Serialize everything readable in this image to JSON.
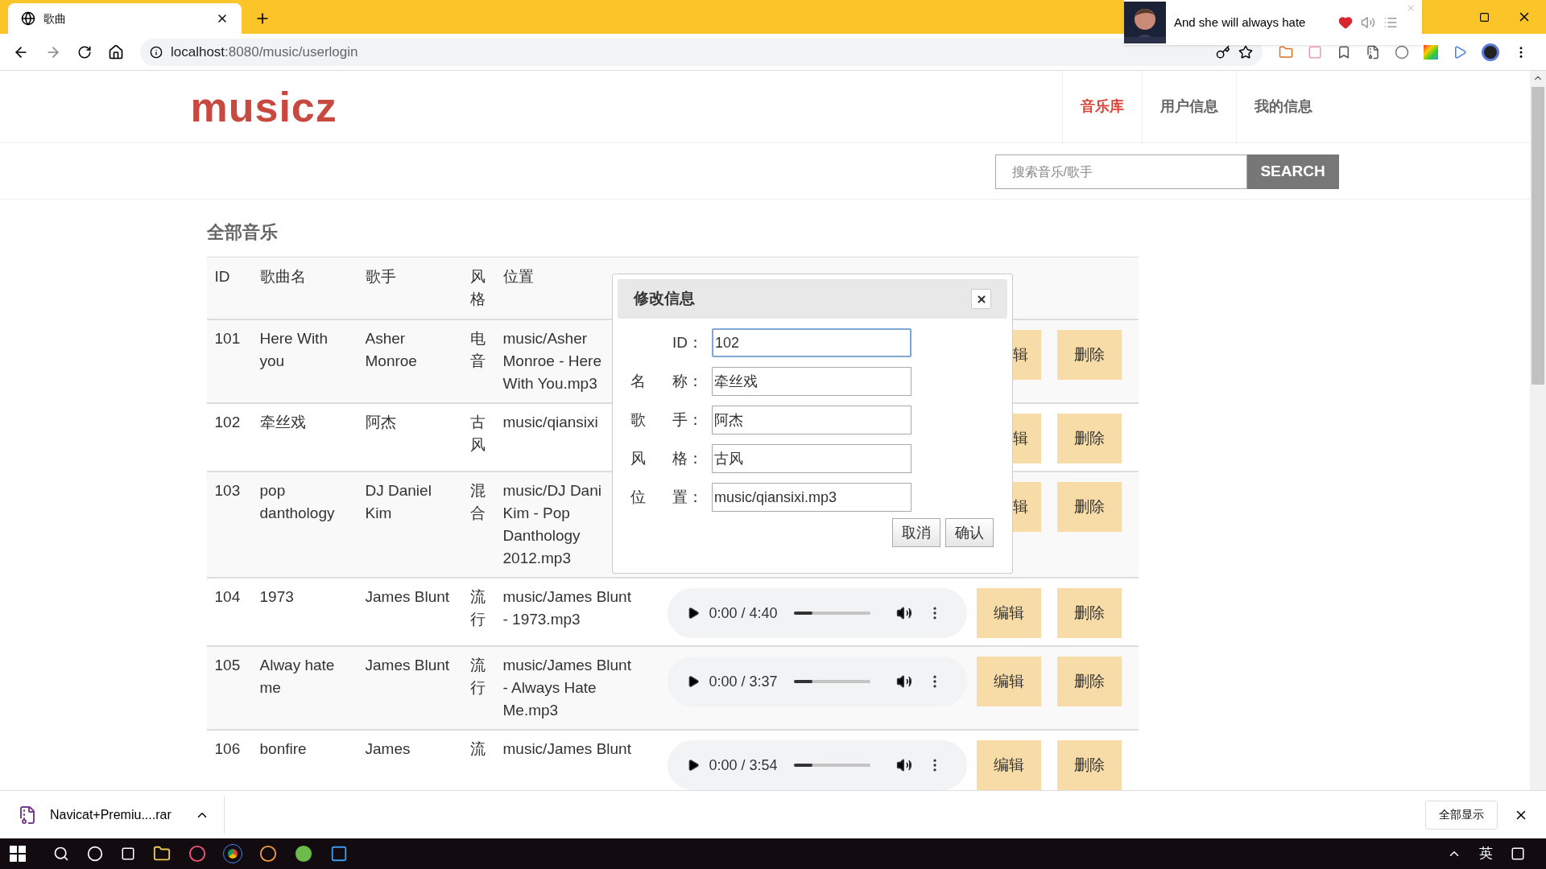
{
  "browser": {
    "tab": {
      "title": "歌曲"
    },
    "url_host": "localhost",
    "url_path": ":8080/music/userlogin",
    "media": {
      "title": "And she will always hate"
    }
  },
  "header": {
    "logo": "musicz",
    "nav": [
      {
        "label": "音乐库",
        "selected": true
      },
      {
        "label": "用户信息",
        "selected": false
      },
      {
        "label": "我的信息",
        "selected": false
      }
    ]
  },
  "search": {
    "placeholder": "搜索音乐/歌手",
    "button": "SEARCH"
  },
  "section_title": "全部音乐",
  "table": {
    "columns": [
      "ID",
      "歌曲名",
      "歌手",
      "风格",
      "位置"
    ],
    "rows": [
      {
        "id": "101",
        "name": "Here With you",
        "singer": "Asher Monroe",
        "style": "电音",
        "location": [
          "music/Asher",
          "Monroe - Here",
          "With You.mp3"
        ],
        "edit": "辑",
        "delete": "删除"
      },
      {
        "id": "102",
        "name": "牵丝戏",
        "singer": "阿杰",
        "style": "古风",
        "location": [
          "music/qiansixi"
        ],
        "edit": "辑",
        "delete": "删除"
      },
      {
        "id": "103",
        "name": "pop danthology",
        "singer": "DJ Daniel Kim",
        "style": "混合",
        "location": [
          "music/DJ Dani",
          "Kim - Pop",
          "Danthology",
          "2012.mp3"
        ],
        "edit": "辑",
        "delete": "删除"
      },
      {
        "id": "104",
        "name": "1973",
        "singer": "James Blunt",
        "style": "流行",
        "location": [
          "music/James Blunt",
          "- 1973.mp3"
        ],
        "player": {
          "time": "0:00 / 4:40",
          "level": 0.25
        },
        "edit": "编辑",
        "delete": "删除"
      },
      {
        "id": "105",
        "name": "Alway hate me",
        "singer": "James Blunt",
        "style": "流行",
        "location": [
          "music/James Blunt",
          "- Always Hate",
          "Me.mp3"
        ],
        "player": {
          "time": "0:00 / 3:37",
          "level": 0.25
        },
        "edit": "编辑",
        "delete": "删除"
      },
      {
        "id": "106",
        "name": "bonfire",
        "singer": "James",
        "style": "流",
        "location": [
          "music/James Blunt"
        ],
        "player": {
          "time": "0:00 / 3:54",
          "level": 0.25
        },
        "edit": "编辑",
        "delete": "删除"
      }
    ]
  },
  "dialog": {
    "title": "修改信息",
    "fields": [
      {
        "label": "ID：",
        "value": "102",
        "focused": true
      },
      {
        "label": "名 称：",
        "value": "牵丝戏",
        "focused": false
      },
      {
        "label": "歌 手：",
        "value": "阿杰",
        "focused": false
      },
      {
        "label": "风 格：",
        "value": "古风",
        "focused": false
      },
      {
        "label": "位 置：",
        "value": "music/qiansixi.mp3",
        "focused": false
      }
    ],
    "buttons": [
      "取消",
      "确认"
    ]
  },
  "downloads": {
    "file": "Navicat+Premiu....rar",
    "show_all": "全部显示"
  },
  "taskbar": {
    "ime": "英"
  }
}
